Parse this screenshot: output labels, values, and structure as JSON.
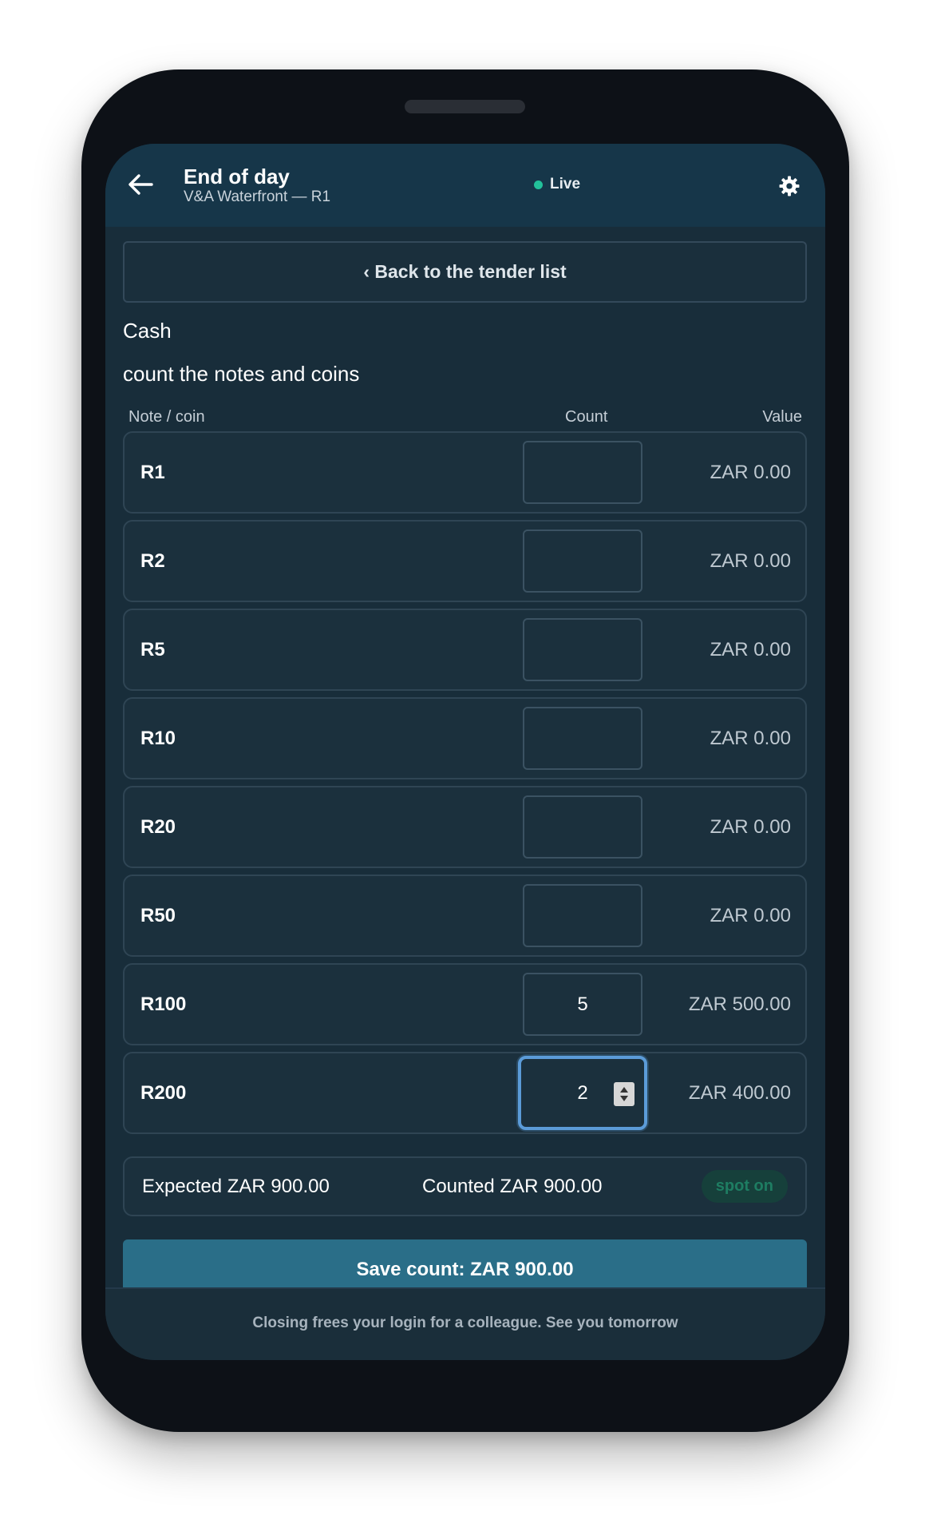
{
  "header": {
    "title": "End of day",
    "subtitle": "V&A Waterfront — R1",
    "status": "Live",
    "status_color": "#22c19a",
    "back_icon": "arrow-left-icon",
    "settings_icon": "gear-icon"
  },
  "back_button": {
    "label": "‹ Back to the tender list"
  },
  "section": {
    "title": "Cash",
    "instruction": "count the notes and coins"
  },
  "columns": {
    "denomination": "Note / coin",
    "count": "Count",
    "value": "Value"
  },
  "rows": [
    {
      "denomination": "R1",
      "count": "",
      "value": "ZAR 0.00"
    },
    {
      "denomination": "R2",
      "count": "",
      "value": "ZAR 0.00"
    },
    {
      "denomination": "R5",
      "count": "",
      "value": "ZAR 0.00"
    },
    {
      "denomination": "R10",
      "count": "",
      "value": "ZAR 0.00"
    },
    {
      "denomination": "R20",
      "count": "",
      "value": "ZAR 0.00"
    },
    {
      "denomination": "R50",
      "count": "",
      "value": "ZAR 0.00"
    },
    {
      "denomination": "R100",
      "count": "5",
      "value": "ZAR 500.00"
    },
    {
      "denomination": "R200",
      "count": "2",
      "value": "ZAR 400.00"
    }
  ],
  "summary": {
    "expected": "Expected ZAR 900.00",
    "counted": "Counted ZAR 900.00",
    "badge": "spot on",
    "badge_color": "#1e7d62"
  },
  "save_button": {
    "label": "Save count: ZAR 900.00"
  },
  "footer": {
    "text": "Closing frees your login for a colleague. See you tomorrow"
  }
}
